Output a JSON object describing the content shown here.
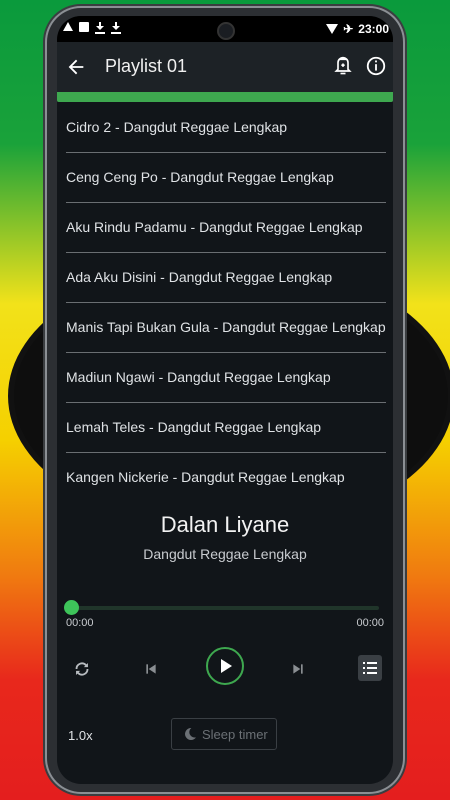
{
  "status_bar": {
    "time": "23:00",
    "left_icons": [
      "alert-icon",
      "image-icon",
      "download-icon",
      "download-icon"
    ],
    "right_icons": [
      "wifi-icon",
      "airplane-icon"
    ]
  },
  "app_bar": {
    "title": "Playlist 01",
    "back_icon": "arrow-left-icon",
    "alarm_icon": "alarm-icon",
    "info_icon": "info-icon"
  },
  "playlist": [
    "Cidro 2 - Dangdut Reggae Lengkap",
    "Ceng Ceng Po - Dangdut Reggae Lengkap",
    "Aku Rindu Padamu - Dangdut Reggae Lengkap",
    "Ada Aku Disini - Dangdut Reggae Lengkap",
    "Manis Tapi Bukan Gula - Dangdut Reggae Lengkap",
    "Madiun Ngawi - Dangdut Reggae Lengkap",
    "Lemah Teles - Dangdut Reggae Lengkap",
    "Kangen Nickerie - Dangdut Reggae Lengkap"
  ],
  "now_playing": {
    "title": "Dalan Liyane",
    "artist": "Dangdut Reggae Lengkap",
    "current_time": "00:00",
    "duration": "00:00",
    "progress": 0
  },
  "controls": {
    "repeat_icon": "repeat-icon",
    "previous_icon": "skip-previous-icon",
    "play_icon": "play-icon",
    "next_icon": "skip-next-icon",
    "queue_icon": "queue-list-icon"
  },
  "footer": {
    "speed": "1.0x",
    "sleep_timer_label": "Sleep timer",
    "sleep_icon": "moon-icon"
  },
  "colors": {
    "accent": "#3ea84f",
    "background": "#111519",
    "app_bar": "#1d2226"
  }
}
